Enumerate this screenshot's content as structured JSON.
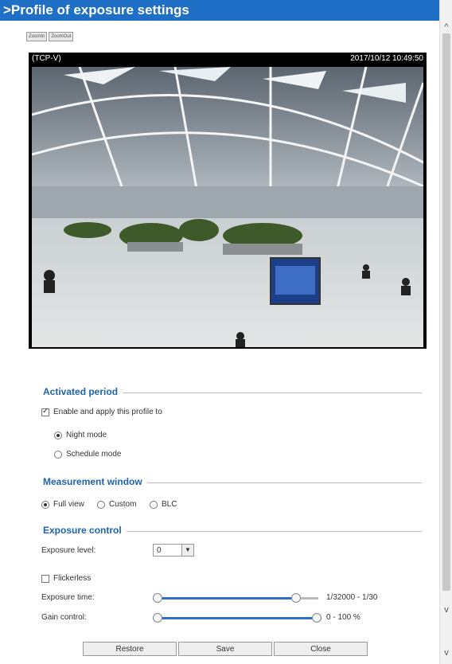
{
  "header": {
    "title": ">Profile of exposure settings"
  },
  "toolbar": {
    "btn1": "ZoomIn",
    "btn2": "ZoomOut"
  },
  "video": {
    "source": "(TCP-V)",
    "timestamp": "2017/10/12 10:49:50"
  },
  "activated_period": {
    "title": "Activated period",
    "enable_label": "Enable and apply this profile to",
    "enable_checked": true,
    "options": [
      {
        "label": "Night mode",
        "checked": true
      },
      {
        "label": "Schedule mode",
        "checked": false
      }
    ]
  },
  "measurement_window": {
    "title": "Measurement window",
    "options": [
      {
        "label": "Full view",
        "checked": true
      },
      {
        "label": "Custom",
        "checked": false
      },
      {
        "label": "BLC",
        "checked": false
      }
    ]
  },
  "exposure_control": {
    "title": "Exposure control",
    "exposure_level_label": "Exposure level:",
    "exposure_level_value": "0",
    "flickerless_label": "Flickerless",
    "flickerless_checked": false,
    "exposure_time_label": "Exposure time:",
    "exposure_time_range": "1/32000 - 1/30",
    "gain_control_label": "Gain control:",
    "gain_control_range": "0 - 100 %"
  },
  "buttons": {
    "restore": "Restore",
    "save": "Save",
    "close": "Close"
  }
}
